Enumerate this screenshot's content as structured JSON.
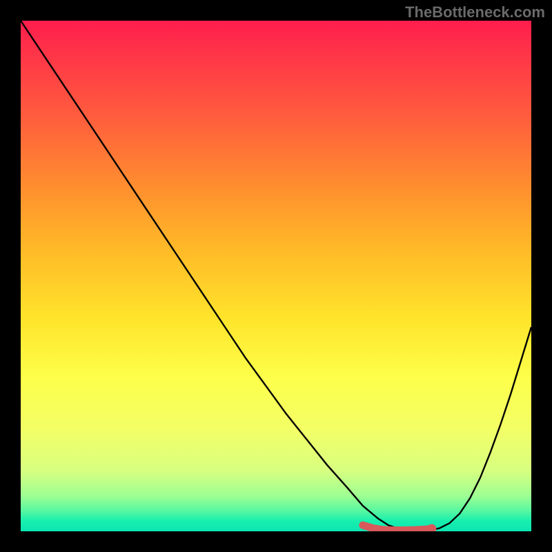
{
  "watermark": "TheBottleneck.com",
  "chart_data": {
    "type": "line",
    "title": "",
    "xlabel": "",
    "ylabel": "",
    "xlim": [
      0,
      100
    ],
    "ylim": [
      0,
      100
    ],
    "series": [
      {
        "name": "bottleneck-curve",
        "x": [
          0,
          4,
          8,
          12,
          16,
          20,
          24,
          28,
          32,
          36,
          40,
          44,
          48,
          52,
          56,
          60,
          64,
          67,
          70,
          72,
          74,
          76,
          78,
          80,
          82,
          84,
          86,
          88,
          90,
          92,
          94,
          96,
          98,
          100
        ],
        "y": [
          100,
          94,
          88,
          82,
          76,
          70,
          64,
          58,
          52,
          46,
          40,
          34,
          28.5,
          23,
          18,
          13,
          8.5,
          5,
          2.5,
          1.2,
          0.5,
          0.2,
          0.1,
          0.2,
          0.6,
          1.6,
          3.5,
          6.5,
          10.5,
          15.5,
          21,
          27,
          33.5,
          40
        ]
      },
      {
        "name": "optimal-segment",
        "x": [
          67,
          69,
          71,
          73,
          75,
          77,
          79,
          80.5
        ],
        "y": [
          1.2,
          0.6,
          0.3,
          0.2,
          0.2,
          0.25,
          0.35,
          0.5
        ]
      }
    ],
    "annotations": [
      {
        "name": "optimal-point",
        "x": 80.5,
        "y": 0.5
      }
    ],
    "background": {
      "type": "vertical-gradient",
      "stops": [
        {
          "pos": 0,
          "color": "#ff1d4d"
        },
        {
          "pos": 18,
          "color": "#ff5a3e"
        },
        {
          "pos": 44,
          "color": "#ffb728"
        },
        {
          "pos": 70,
          "color": "#fdff4a"
        },
        {
          "pos": 93,
          "color": "#9fff92"
        },
        {
          "pos": 100,
          "color": "#0de5b2"
        }
      ]
    }
  }
}
